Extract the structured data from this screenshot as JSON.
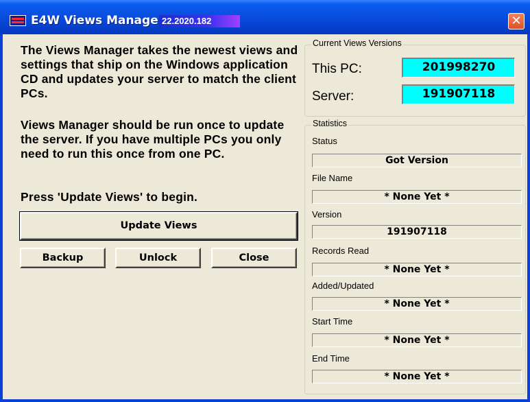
{
  "window": {
    "title": "E4W Views Manager",
    "version": "22.2020.182",
    "close_glyph": "✕",
    "colors": {
      "titlebar": "#0848d8",
      "version_box_cyan": "#00ffff",
      "body": "#ece9d8"
    }
  },
  "description": {
    "paragraph1": "The Views Manager takes the newest views and settings that ship on the Windows application CD and updates your server to match the client PCs.",
    "paragraph2": "Views Manager should be run once to update the server. If you have multiple PCs you only need to run this once from one PC.",
    "paragraph3": "Press 'Update Views' to begin."
  },
  "buttons": {
    "update": "Update Views",
    "backup": "Backup",
    "unlock": "Unlock",
    "close": "Close"
  },
  "versions": {
    "legend": "Current Views Versions",
    "this_pc_label": "This PC:",
    "this_pc_value": "201998270",
    "server_label": "Server:",
    "server_value": "191907118"
  },
  "statistics": {
    "legend": "Statistics",
    "fields": [
      {
        "label": "Status",
        "value": "Got Version"
      },
      {
        "label": "File Name",
        "value": "* None Yet *"
      },
      {
        "label": "Version",
        "value": "191907118"
      },
      {
        "label": "Records Read",
        "value": "* None Yet *"
      },
      {
        "label": "Added/Updated",
        "value": "* None Yet *"
      },
      {
        "label": "Start Time",
        "value": "* None Yet *"
      },
      {
        "label": "End Time",
        "value": "* None Yet *"
      }
    ]
  }
}
